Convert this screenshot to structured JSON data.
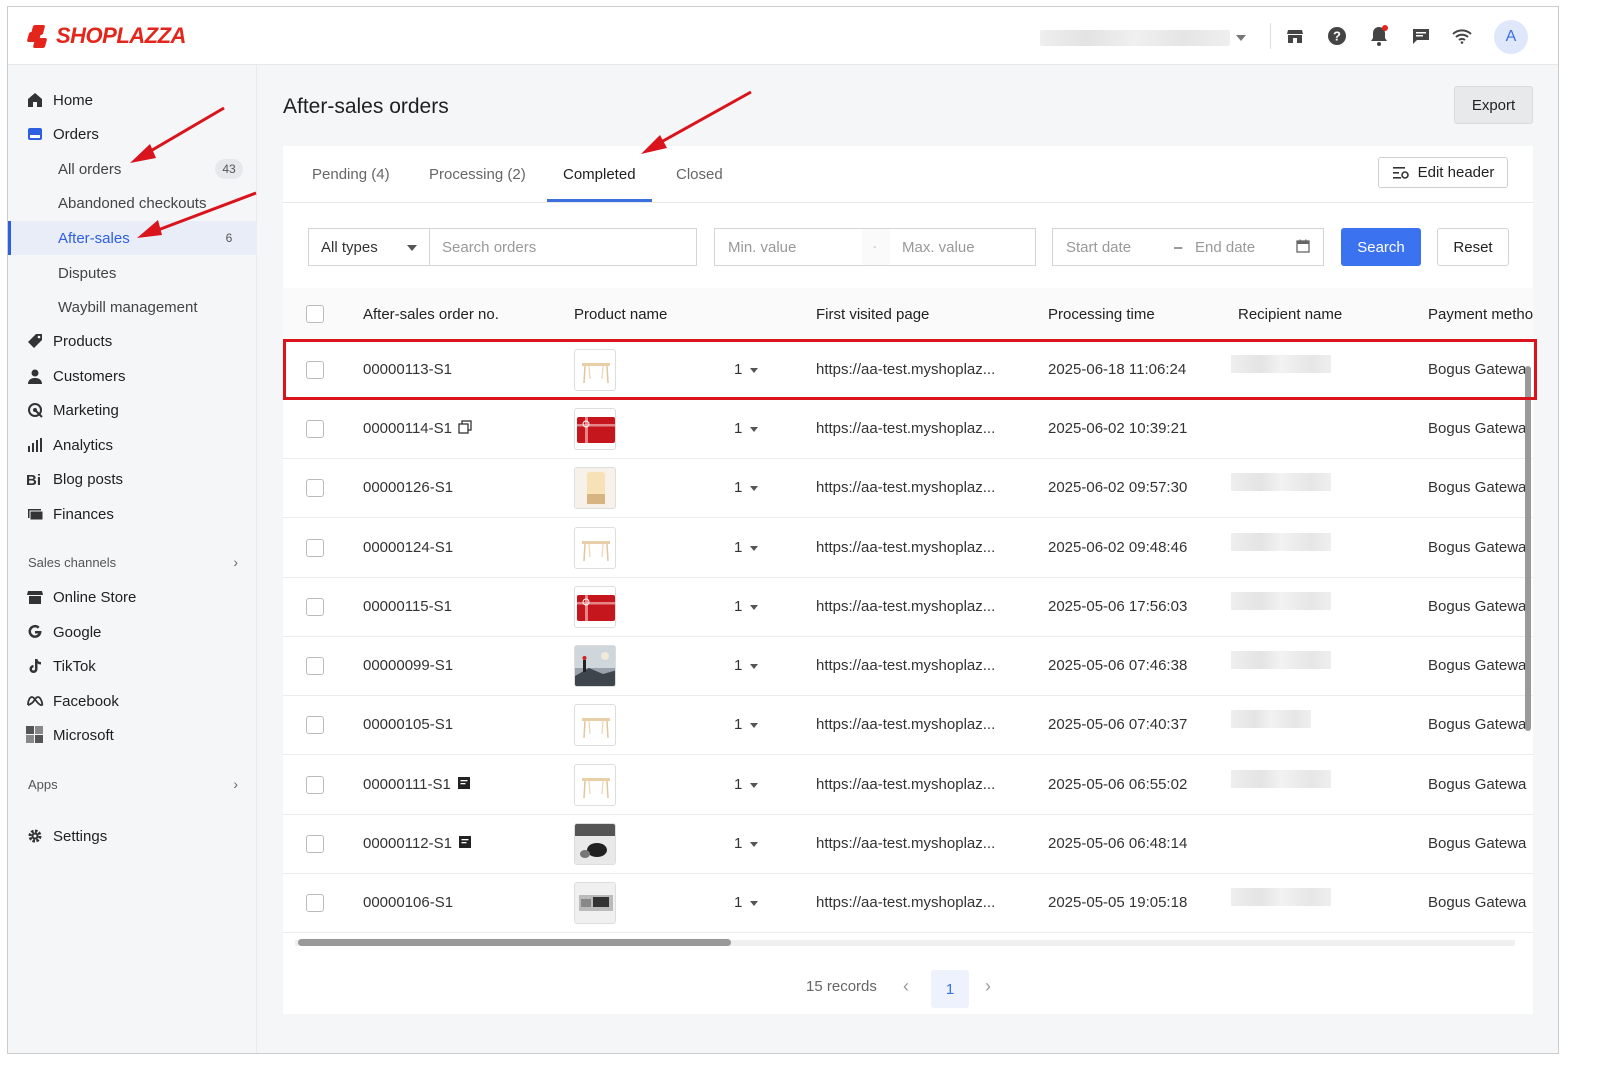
{
  "brand": {
    "name": "SHOPLAZZA",
    "color": "#e4251b",
    "accent": "#3b6fe0"
  },
  "topbar": {
    "avatar_letter": "A",
    "icons": [
      "store-icon",
      "help-icon",
      "bell-icon",
      "chat-icon",
      "wifi-icon"
    ]
  },
  "sidebar": {
    "items": [
      {
        "label": "Home",
        "icon": "home-icon"
      },
      {
        "label": "Orders",
        "icon": "orders-icon"
      },
      {
        "label": "All orders",
        "badge": "43"
      },
      {
        "label": "Abandoned checkouts"
      },
      {
        "label": "After-sales",
        "badge": "6"
      },
      {
        "label": "Disputes"
      },
      {
        "label": "Waybill management"
      },
      {
        "label": "Products",
        "icon": "tag-icon"
      },
      {
        "label": "Customers",
        "icon": "person-icon"
      },
      {
        "label": "Marketing",
        "icon": "marketing-icon"
      },
      {
        "label": "Analytics",
        "icon": "analytics-icon"
      },
      {
        "label": "Blog posts",
        "icon": "blog-icon"
      },
      {
        "label": "Finances",
        "icon": "finances-icon"
      }
    ],
    "sales_channels_label": "Sales channels",
    "channels": [
      {
        "label": "Online Store",
        "icon": "store-icon"
      },
      {
        "label": "Google",
        "icon": "google-icon"
      },
      {
        "label": "TikTok",
        "icon": "tiktok-icon"
      },
      {
        "label": "Facebook",
        "icon": "meta-icon"
      },
      {
        "label": "Microsoft",
        "icon": "microsoft-icon"
      }
    ],
    "apps_label": "Apps",
    "settings_label": "Settings"
  },
  "page": {
    "title": "After-sales orders",
    "export_label": "Export"
  },
  "tabs": [
    {
      "label": "Pending",
      "count": "(4)"
    },
    {
      "label": "Processing",
      "count": "(2)"
    },
    {
      "label": "Completed",
      "count": ""
    },
    {
      "label": "Closed",
      "count": ""
    }
  ],
  "edit_header_label": "Edit header",
  "filters": {
    "type_value": "All types",
    "search_placeholder": "Search orders",
    "min_placeholder": "Min. value",
    "max_placeholder": "Max. value",
    "start_placeholder": "Start date",
    "end_placeholder": "End date",
    "search_label": "Search",
    "reset_label": "Reset"
  },
  "table": {
    "headers": [
      "After-sales order no.",
      "Product name",
      "First visited page",
      "Processing time",
      "Recipient name",
      "Payment metho"
    ],
    "rows": [
      {
        "order": "00000113-S1",
        "qty": "1",
        "page": "https://aa-test.myshoplaz...",
        "time": "2025-06-18 11:06:24",
        "payment": "Bogus Gatewa",
        "thumb": "table"
      },
      {
        "order": "00000114-S1",
        "qty": "1",
        "page": "https://aa-test.myshoplaz...",
        "time": "2025-06-02 10:39:21",
        "payment": "Bogus Gatewa",
        "thumb": "giftcard",
        "icon": "copy-icon"
      },
      {
        "order": "00000126-S1",
        "qty": "1",
        "page": "https://aa-test.myshoplaz...",
        "time": "2025-06-02 09:57:30",
        "payment": "Bogus Gatewa",
        "thumb": "lamp"
      },
      {
        "order": "00000124-S1",
        "qty": "1",
        "page": "https://aa-test.myshoplaz...",
        "time": "2025-06-02 09:48:46",
        "payment": "Bogus Gatewa",
        "thumb": "table"
      },
      {
        "order": "00000115-S1",
        "qty": "1",
        "page": "https://aa-test.myshoplaz...",
        "time": "2025-05-06 17:56:03",
        "payment": "Bogus Gatewa",
        "thumb": "giftcard"
      },
      {
        "order": "00000099-S1",
        "qty": "1",
        "page": "https://aa-test.myshoplaz...",
        "time": "2025-05-06 07:46:38",
        "payment": "Bogus Gatewa",
        "thumb": "photo"
      },
      {
        "order": "00000105-S1",
        "qty": "1",
        "page": "https://aa-test.myshoplaz...",
        "time": "2025-05-06 07:40:37",
        "payment": "Bogus Gatewa",
        "thumb": "table"
      },
      {
        "order": "00000111-S1",
        "qty": "1",
        "page": "https://aa-test.myshoplaz...",
        "time": "2025-05-06 06:55:02",
        "payment": "Bogus Gatewa",
        "thumb": "table",
        "icon": "note-icon"
      },
      {
        "order": "00000112-S1",
        "qty": "1",
        "page": "https://aa-test.myshoplaz...",
        "time": "2025-05-06 06:48:14",
        "payment": "Bogus Gatewa",
        "thumb": "mouse",
        "icon": "note-icon"
      },
      {
        "order": "00000106-S1",
        "qty": "1",
        "page": "https://aa-test.myshoplaz...",
        "time": "2025-05-05 19:05:18",
        "payment": "Bogus Gatewa",
        "thumb": "desk"
      }
    ]
  },
  "pagination": {
    "records": "15 records",
    "current": "1"
  }
}
